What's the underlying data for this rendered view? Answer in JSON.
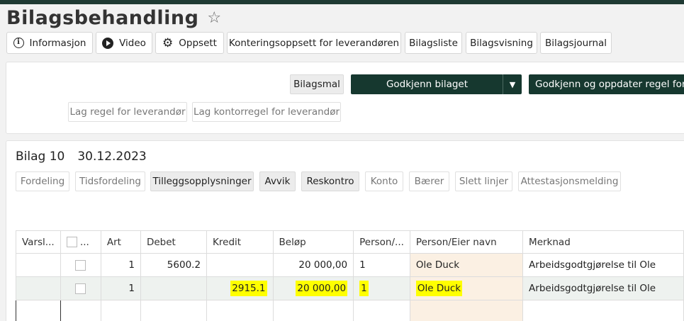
{
  "page": {
    "title": "Bilagsbehandling",
    "star_icon": "star-outline-icon"
  },
  "toolbar": {
    "info_label": "Informasjon",
    "info_icon": "info-icon",
    "video_label": "Video",
    "video_icon": "play-icon",
    "setup_label": "Oppsett",
    "setup_icon": "gear-icon",
    "kontering_label": "Konteringsoppsett for leverandøren",
    "bilagsliste_label": "Bilagsliste",
    "bilagsvisning_label": "Bilagsvisning",
    "bilagsjournal_label": "Bilagsjournal"
  },
  "actions": {
    "bilagsmal_label": "Bilagsmal",
    "approve_label": "Godkjenn bilaget",
    "approve_dropdown": "▼",
    "approve_update_label": "Godkjenn og oppdater regel for fi",
    "rule_supplier_label": "Lag regel for leverandør",
    "office_rule_label": "Lag kontorregel for leverandør"
  },
  "bilag": {
    "number": "Bilag 10",
    "date": "30.12.2023"
  },
  "tabs": [
    {
      "label": "Fordeling",
      "active": false
    },
    {
      "label": "Tidsfordeling",
      "active": false
    },
    {
      "label": "Tilleggsopplysninger",
      "active": true
    },
    {
      "label": "Avvik",
      "active": true
    },
    {
      "label": "Reskontro",
      "active": true
    },
    {
      "label": "Konto",
      "active": false
    },
    {
      "label": "Bærer",
      "active": false
    },
    {
      "label": "Slett linjer",
      "active": false
    },
    {
      "label": "Attestasjonsmelding",
      "active": false
    }
  ],
  "table": {
    "headers": [
      "Varsl...",
      "...",
      "Art",
      "Debet",
      "Kredit",
      "Beløp",
      "Person/...",
      "Person/Eier navn",
      "Merknad"
    ],
    "rows": [
      {
        "art": "1",
        "debet": "5600.2",
        "kredit": "",
        "belop": "20 000,00",
        "person": "1",
        "navn": "Ole Duck",
        "merknad": "Arbeidsgodtgjørelse til Ole"
      },
      {
        "art": "1",
        "debet": "",
        "kredit": "2915.1",
        "belop": "20 000,00",
        "person": "1",
        "navn": "Ole Duck",
        "merknad": "Arbeidsgodtgjørelse til Ole"
      }
    ]
  },
  "colors": {
    "accent_dark": "#16382f",
    "highlight": "#ffff00",
    "name_column_bg": "#fbf0e3"
  }
}
